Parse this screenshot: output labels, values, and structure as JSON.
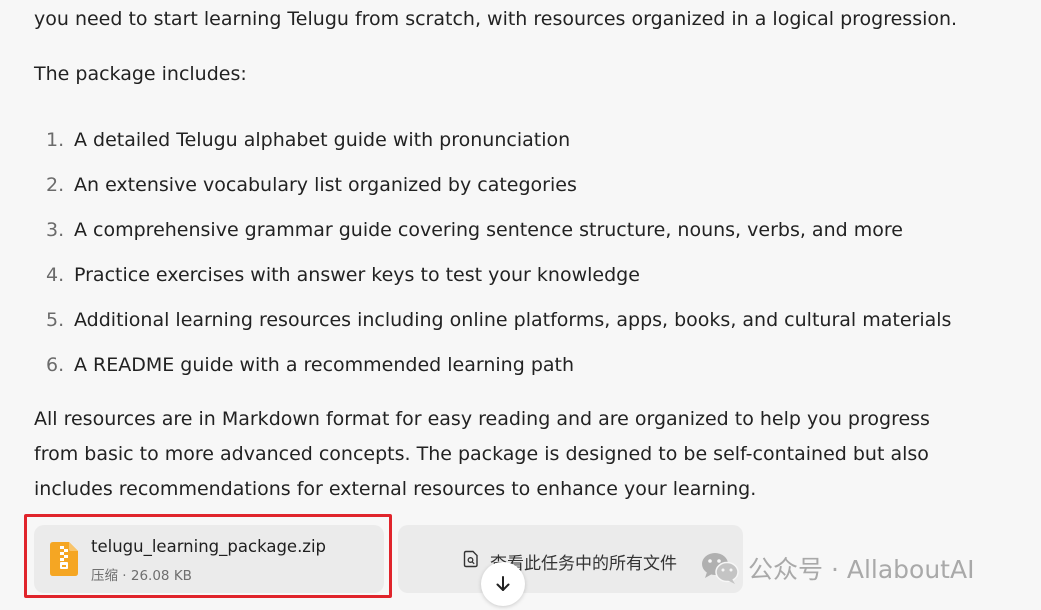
{
  "message": {
    "intro_line": "you need to start learning Telugu from scratch, with resources organized in a logical progression.",
    "includes_label": "The package includes:",
    "items": [
      {
        "num": "1.",
        "text": "A detailed Telugu alphabet guide with pronunciation"
      },
      {
        "num": "2.",
        "text": "An extensive vocabulary list organized by categories"
      },
      {
        "num": "3.",
        "text": "A comprehensive grammar guide covering sentence structure, nouns, verbs, and more"
      },
      {
        "num": "4.",
        "text": "Practice exercises with answer keys to test your knowledge"
      },
      {
        "num": "5.",
        "text": "Additional learning resources including online platforms, apps, books, and cultural materials"
      },
      {
        "num": "6.",
        "text": "A README guide with a recommended learning path"
      }
    ],
    "summary": "All resources are in Markdown format for easy reading and are organized to help you progress from basic to more advanced concepts. The package is designed to be self-contained but also includes recommendations for external resources to enhance your learning."
  },
  "attachment": {
    "file_name": "telugu_learning_package.zip",
    "file_meta": "压缩 · 26.08 KB",
    "icon": "zip-file-icon",
    "icon_color": "#f5a623"
  },
  "all_files_button": {
    "label": "查看此任务中的所有文件",
    "icon": "document-icon"
  },
  "scroll_button": {
    "icon": "arrow-down-icon"
  },
  "watermark": {
    "text": "公众号 · AllaboutAI",
    "icon": "wechat-icon"
  },
  "colors": {
    "highlight_border": "#e0242b",
    "background": "#f7f7f7",
    "card_background": "#ebebeb"
  }
}
